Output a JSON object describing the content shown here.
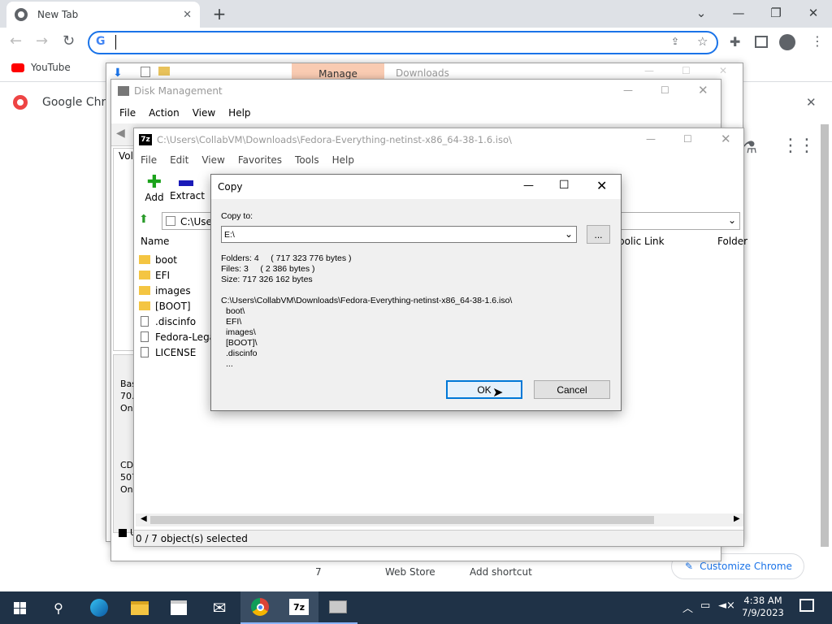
{
  "chrome": {
    "tab_title": "New Tab",
    "omnibox_value": "",
    "bookmarks": [
      {
        "label": "YouTube"
      }
    ],
    "page": {
      "google_chrome_label": "Google Chrom",
      "shortcut_1": "7",
      "shortcut_2": "Web Store",
      "shortcut_3": "Add shortcut",
      "customize_label": "Customize Chrome"
    }
  },
  "explorer": {
    "ribbon_tab": "Manage",
    "title": "Downloads"
  },
  "disk_management": {
    "title": "Disk Management",
    "menu": [
      "File",
      "Action",
      "View",
      "Help"
    ],
    "col_volume": "Volu",
    "disk0": [
      "Basi",
      "70.0",
      "Onl"
    ],
    "cdrom": [
      "CD-",
      "507",
      "Onl"
    ],
    "status_letter": "U"
  },
  "sevenzip": {
    "title": "C:\\Users\\CollabVM\\Downloads\\Fedora-Everything-netinst-x86_64-38-1.6.iso\\",
    "menu": [
      "File",
      "Edit",
      "View",
      "Favorites",
      "Tools",
      "Help"
    ],
    "toolbar": {
      "add": "Add",
      "extract": "Extract"
    },
    "address": "C:\\User",
    "columns": {
      "name": "Name",
      "symlink": "bolic Link",
      "folders": "Folder"
    },
    "files": [
      {
        "name": "boot",
        "type": "folder"
      },
      {
        "name": "EFI",
        "type": "folder"
      },
      {
        "name": "images",
        "type": "folder"
      },
      {
        "name": "[BOOT]",
        "type": "folder"
      },
      {
        "name": ".discinfo",
        "type": "file"
      },
      {
        "name": "Fedora-Legal-",
        "type": "file"
      },
      {
        "name": "LICENSE",
        "type": "file"
      }
    ],
    "status": "0 / 7 object(s) selected"
  },
  "copy_dialog": {
    "title": "Copy",
    "copy_to_label": "Copy to:",
    "destination": "E:\\",
    "browse_label": "...",
    "summary": {
      "folders": "Folders: 4     ( 717 323 776 bytes )",
      "files": "Files: 3     ( 2 386 bytes )",
      "size": "Size: 717 326 162 bytes"
    },
    "path": "C:\\Users\\CollabVM\\Downloads\\Fedora-Everything-netinst-x86_64-38-1.6.iso\\",
    "items": [
      "boot\\",
      "EFI\\",
      "images\\",
      "[BOOT]\\",
      ".discinfo",
      "..."
    ],
    "ok_label": "OK",
    "cancel_label": "Cancel"
  },
  "taskbar": {
    "time": "4:38 AM",
    "date": "7/9/2023"
  }
}
